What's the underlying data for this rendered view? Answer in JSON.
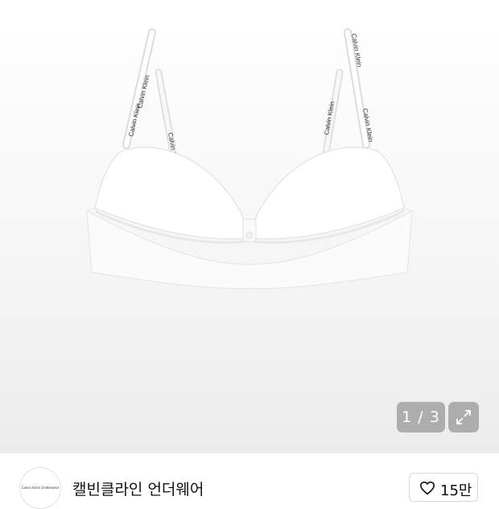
{
  "product": {
    "strap_text": "Calvin Klein",
    "image_counter": "1 / 3"
  },
  "brand": {
    "logo_text": "Calvin Klein Underwear",
    "name": "캘빈클라인 언더웨어"
  },
  "like": {
    "count": "15만"
  },
  "icons": {
    "expand": "expand-icon",
    "heart": "heart-icon"
  }
}
